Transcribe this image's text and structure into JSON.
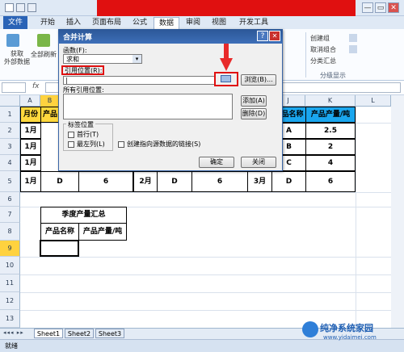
{
  "title_bar": {
    "text": "",
    "win_restore": "▭",
    "win_close": "✕",
    "win_minimize": "—"
  },
  "tabs": [
    "文件",
    "开始",
    "插入",
    "页面布局",
    "公式",
    "数据",
    "审阅",
    "视图",
    "开发工具"
  ],
  "ribbon": {
    "get_external": "获取\n外部数据",
    "refresh_all": "全部刷新",
    "create_group": "创建组",
    "ungroup": "取消组合",
    "subtotal": "分类汇总",
    "group_label": "分级显示"
  },
  "formula_bar": {
    "name_box": "",
    "fx": "fx",
    "value": ""
  },
  "columns": [
    "A",
    "B",
    "J",
    "K",
    "L"
  ],
  "rows": [
    "1",
    "2",
    "3",
    "4",
    "5",
    "6",
    "7",
    "8",
    "9",
    "10",
    "11",
    "12",
    "13"
  ],
  "sheet": {
    "left_table": {
      "headers": [
        "月份",
        "产品"
      ],
      "rows": [
        [
          "1月",
          "A"
        ],
        [
          "1月",
          "B"
        ],
        [
          "1月",
          "C"
        ],
        [
          "1月",
          "D"
        ]
      ]
    },
    "left_table_values": [
      "6"
    ],
    "mid_table": {
      "rows": [
        [
          "2月",
          "D",
          "6"
        ]
      ]
    },
    "right_table": {
      "headers": [
        "产品名称",
        "产品产量/吨"
      ],
      "rows": [
        [
          "A",
          "2.5"
        ],
        [
          "B",
          "2"
        ],
        [
          "C",
          "4"
        ],
        [
          "D",
          "6"
        ]
      ]
    },
    "right_month": "3月",
    "summary": {
      "title": "季度产量汇总",
      "col1": "产品名称",
      "col2": "产品产量/吨"
    }
  },
  "dialog": {
    "title": "合并计算",
    "help": "?",
    "close": "✕",
    "function_label": "函数(F):",
    "function_value": "求和",
    "ref_label": "引用位置(R):",
    "ref_value": "|",
    "browse": "浏览(B)...",
    "all_refs_label": "所有引用位置:",
    "add": "添加(A)",
    "delete": "删除(D)",
    "label_position": "标签位置",
    "top_row": "首行(T)",
    "left_col": "最左列(L)",
    "link_source": "创建指向源数据的链接(S)",
    "ok": "确定",
    "cancel": "关闭"
  },
  "sheet_tabs": [
    "Sheet1",
    "Sheet2",
    "Sheet3"
  ],
  "status": {
    "mode": "就绪"
  },
  "colors": {
    "accent": "#e01010",
    "yellow": "#ffd83d",
    "blue": "#1aa6ee"
  },
  "watermark": {
    "brand": "纯净系统家园",
    "url": "www.yidaimei.com"
  }
}
